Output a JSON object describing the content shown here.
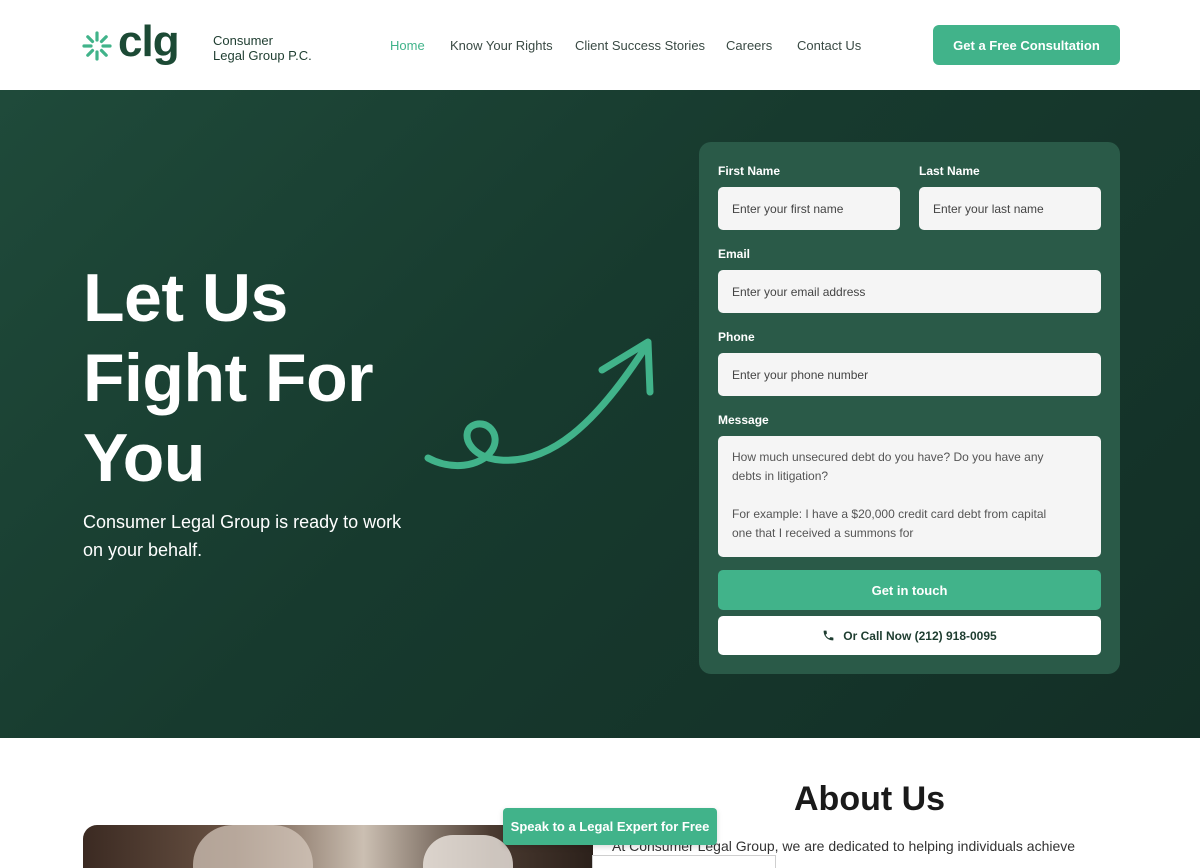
{
  "header": {
    "logo_text": "clg",
    "logo_sub_line1": "Consumer",
    "logo_sub_line2": "Legal Group P.C.",
    "nav": [
      "Home",
      "Know Your Rights",
      "Client Success Stories",
      "Careers",
      "Contact Us"
    ],
    "cta_label": "Get a Free Consultation"
  },
  "hero": {
    "title_line1": "Let Us",
    "title_line2": "Fight For",
    "title_line3": "You",
    "subtitle": "Consumer Legal Group is ready to work on your behalf."
  },
  "form": {
    "first_name_label": "First Name",
    "first_name_placeholder": "Enter your first name",
    "last_name_label": "Last Name",
    "last_name_placeholder": "Enter your last name",
    "email_label": "Email",
    "email_placeholder": "Enter your email address",
    "phone_label": "Phone",
    "phone_placeholder": "Enter your phone number",
    "message_label": "Message",
    "message_line1": "How much unsecured debt do you have? Do you have any",
    "message_line2": "debts in litigation?",
    "message_line3": "For example: I have a $20,000 credit card debt from capital",
    "message_line4": "one that I received a summons for",
    "submit_label": "Get in touch",
    "call_label": "Or Call Now (212) 918-0095"
  },
  "about": {
    "title": "About Us",
    "text": "At Consumer Legal Group, we are dedicated to helping individuals achieve",
    "speak_label": "Speak to a Legal Expert for Free"
  },
  "colors": {
    "accent": "#41b38a",
    "brand_dark": "#1c4a35",
    "hero_bg": "#173a2e",
    "form_bg": "#2a5a48"
  },
  "icons": {
    "logo": "starburst-logo-icon",
    "arrow": "curly-arrow-icon",
    "phone": "phone-icon"
  }
}
